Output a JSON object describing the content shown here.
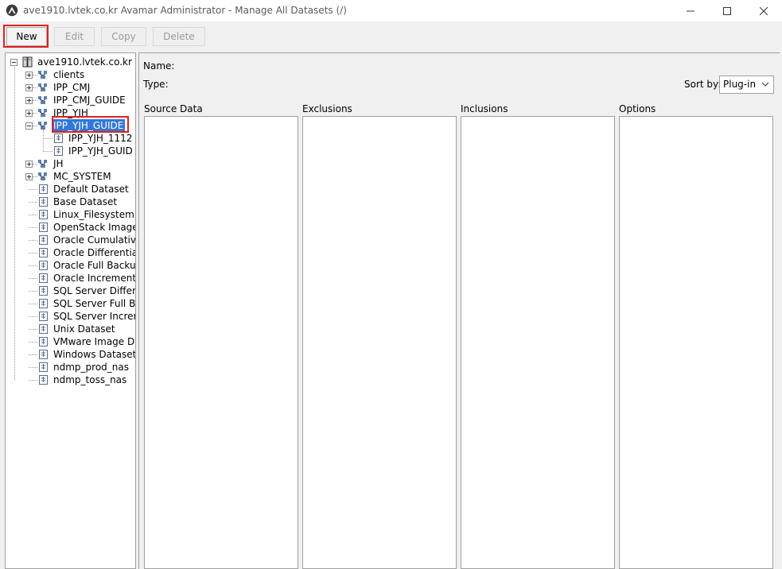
{
  "window": {
    "title": "ave1910.lvtek.co.kr Avamar Administrator - Manage All Datasets (/)",
    "app_icon": "avamar-logo-icon"
  },
  "toolbar": {
    "new_label": "New",
    "edit_label": "Edit",
    "copy_label": "Copy",
    "delete_label": "Delete"
  },
  "tree": {
    "root": "ave1910.lvtek.co.kr",
    "items": [
      {
        "label": "clients"
      },
      {
        "label": "IPP_CMJ"
      },
      {
        "label": "IPP_CMJ_GUIDE"
      },
      {
        "label": "IPP_YJH"
      },
      {
        "label": "IPP_YJH_GUIDE"
      },
      {
        "label": "IPP_YJH_1112"
      },
      {
        "label": "IPP_YJH_GUID"
      },
      {
        "label": "JH"
      },
      {
        "label": "MC_SYSTEM"
      },
      {
        "label": "Default Dataset"
      },
      {
        "label": "Base Dataset"
      },
      {
        "label": "Linux_Filesystem"
      },
      {
        "label": "OpenStack Image"
      },
      {
        "label": "Oracle Cumulative"
      },
      {
        "label": "Oracle Differential"
      },
      {
        "label": "Oracle Full Backup"
      },
      {
        "label": "Oracle Incremental"
      },
      {
        "label": "SQL Server Differe"
      },
      {
        "label": "SQL Server Full Ba"
      },
      {
        "label": "SQL Server Increm"
      },
      {
        "label": "Unix Dataset"
      },
      {
        "label": "VMware Image Dat"
      },
      {
        "label": "Windows Dataset"
      },
      {
        "label": "ndmp_prod_nas"
      },
      {
        "label": "ndmp_toss_nas"
      }
    ]
  },
  "details": {
    "name_label": "Name:",
    "type_label": "Type:",
    "sort_label": "Sort by:",
    "sort_value": "Plug-in",
    "columns": [
      "Source Data",
      "Exclusions",
      "Inclusions",
      "Options"
    ]
  },
  "colors": {
    "selection": "#3078d8",
    "highlight_box": "#e02020"
  }
}
